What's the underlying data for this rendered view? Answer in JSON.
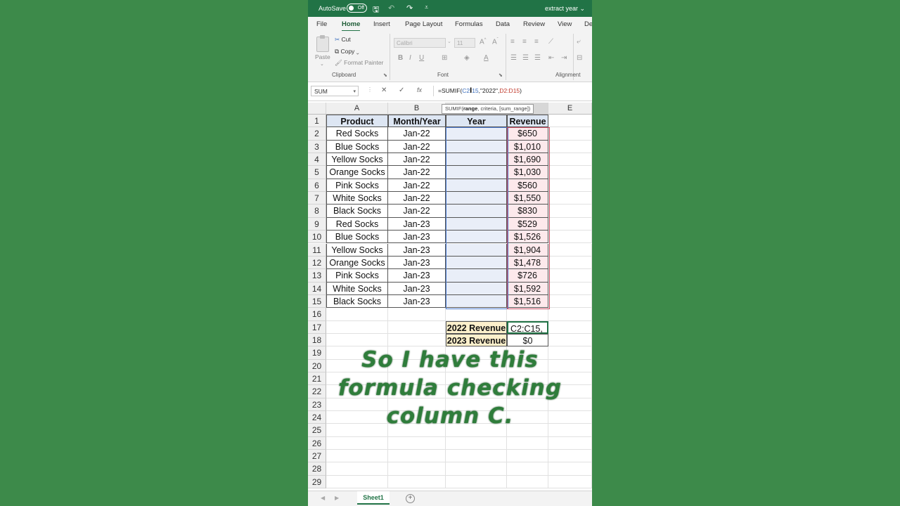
{
  "titlebar": {
    "autosave_label": "AutoSave",
    "autosave_state": "Off",
    "filename": "extract year ⌄"
  },
  "ribbon": {
    "tabs": [
      "File",
      "Home",
      "Insert",
      "Page Layout",
      "Formulas",
      "Data",
      "Review",
      "View",
      "De"
    ],
    "active_tab": "Home",
    "clipboard": {
      "paste": "Paste",
      "cut": "Cut",
      "copy": "Copy",
      "format_painter": "Format Painter",
      "group": "Clipboard"
    },
    "font": {
      "name": "Calibri",
      "size": "11",
      "group": "Font"
    },
    "alignment": {
      "group": "Alignment"
    }
  },
  "formula_bar": {
    "name_box": "SUM",
    "formula_prefix": "=SUMIF(",
    "formula_range1": "C2",
    "formula_mid": ":",
    "formula_range1b": "15",
    "formula_crit": ",\"2022\",",
    "formula_range2": "D2:D15",
    "formula_suffix": ")",
    "tooltip_func": "SUMIF(",
    "tooltip_arg": "range",
    "tooltip_rest": ", criteria, [sum_range])"
  },
  "sheet": {
    "columns": [
      "A",
      "B",
      "C",
      "D",
      "E"
    ],
    "headers": [
      "Product",
      "Month/Year",
      "Year",
      "Revenue"
    ],
    "rows": [
      [
        "Red Socks",
        "Jan-22",
        "",
        "$650"
      ],
      [
        "Blue Socks",
        "Jan-22",
        "",
        "$1,010"
      ],
      [
        "Yellow Socks",
        "Jan-22",
        "",
        "$1,690"
      ],
      [
        "Orange Socks",
        "Jan-22",
        "",
        "$1,030"
      ],
      [
        "Pink Socks",
        "Jan-22",
        "",
        "$560"
      ],
      [
        "White Socks",
        "Jan-22",
        "",
        "$1,550"
      ],
      [
        "Black Socks",
        "Jan-22",
        "",
        "$830"
      ],
      [
        "Red Socks",
        "Jan-23",
        "",
        "$529"
      ],
      [
        "Blue Socks",
        "Jan-23",
        "",
        "$1,526"
      ],
      [
        "Yellow Socks",
        "Jan-23",
        "",
        "$1,904"
      ],
      [
        "Orange Socks",
        "Jan-23",
        "",
        "$1,478"
      ],
      [
        "Pink Socks",
        "Jan-23",
        "",
        "$726"
      ],
      [
        "White Socks",
        "Jan-23",
        "",
        "$1,592"
      ],
      [
        "Black Socks",
        "Jan-23",
        "",
        "$1,516"
      ]
    ],
    "summary": [
      {
        "label": "2022 Revenue",
        "value": "C2:C15,"
      },
      {
        "label": "2023 Revenue",
        "value": "$0"
      }
    ],
    "row_count": 29
  },
  "overlay_caption": "So I have this formula checking column C.",
  "sheet_tabs": {
    "active": "Sheet1"
  }
}
